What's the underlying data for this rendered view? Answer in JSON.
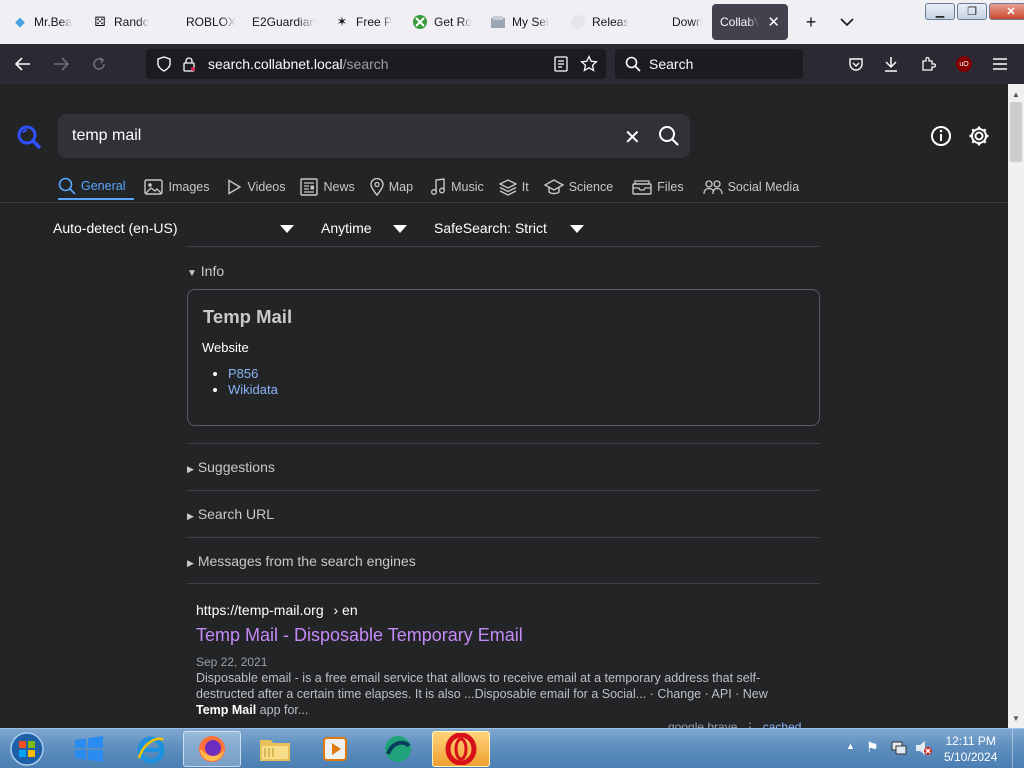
{
  "browser": {
    "tabs": [
      {
        "title": "Mr.Bea",
        "icon": "mrbeast-favicon"
      },
      {
        "title": "Rando",
        "icon": "dice-icon"
      },
      {
        "title": "ROBLOX G",
        "icon": "roblox-favicon"
      },
      {
        "title": "E2Guardian",
        "icon": "e2guardian-favicon"
      },
      {
        "title": "Free P",
        "icon": "freep-favicon"
      },
      {
        "title": "Get Ro",
        "icon": "xbox-icon"
      },
      {
        "title": "My Set",
        "icon": "settings-favicon"
      },
      {
        "title": "Releas",
        "icon": "github-icon"
      },
      {
        "title": "Downl",
        "icon": "download-favicon"
      },
      {
        "title": "CollabV",
        "icon": "collabvm-favicon",
        "active": true
      }
    ],
    "new_tab": "+",
    "list_all_tabs": "⌄",
    "url": {
      "host": "search.collabnet.local",
      "path": "/search"
    },
    "search_placeholder": "Search",
    "ublock_badge": "uO"
  },
  "page": {
    "query": "temp mail",
    "categories": [
      {
        "label": "General",
        "active": true
      },
      {
        "label": "Images"
      },
      {
        "label": "Videos"
      },
      {
        "label": "News"
      },
      {
        "label": "Map"
      },
      {
        "label": "Music"
      },
      {
        "label": "It"
      },
      {
        "label": "Science"
      },
      {
        "label": "Files"
      },
      {
        "label": "Social Media"
      }
    ],
    "filters": {
      "language": "Auto-detect (en-US)",
      "time": "Anytime",
      "safesearch": "SafeSearch: Strict"
    },
    "info": {
      "summary": "Info",
      "title": "Temp Mail",
      "label": "Website",
      "links": [
        "P856",
        "Wikidata"
      ]
    },
    "sections": [
      "Suggestions",
      "Search URL",
      "Messages from the search engines"
    ],
    "result": {
      "url": "https://temp-mail.org",
      "url_suffix": "› en",
      "title": "Temp Mail - Disposable Temporary Email",
      "date": "Sep 22, 2021",
      "snippet": "Disposable email - is a free email service that allows to receive email at a temporary address that self-destructed after a certain time elapses. It is also ...Disposable email for a Social... · Change · API · New",
      "snippet_bold": "Temp Mail",
      "snippet_end": " app for...",
      "engines": "google  brave",
      "cached": "cached"
    }
  },
  "taskbar": {
    "time": "12:11 PM",
    "date": "5/10/2024",
    "apps": [
      "start-orb",
      "windows-logo",
      "internet-explorer",
      "firefox",
      "file-explorer",
      "media-player",
      "collab-app",
      "opera"
    ]
  },
  "colors": {
    "accent": "#58a6ff",
    "visited": "#c58af9",
    "link": "#8ab4f8",
    "background": "#222426"
  }
}
